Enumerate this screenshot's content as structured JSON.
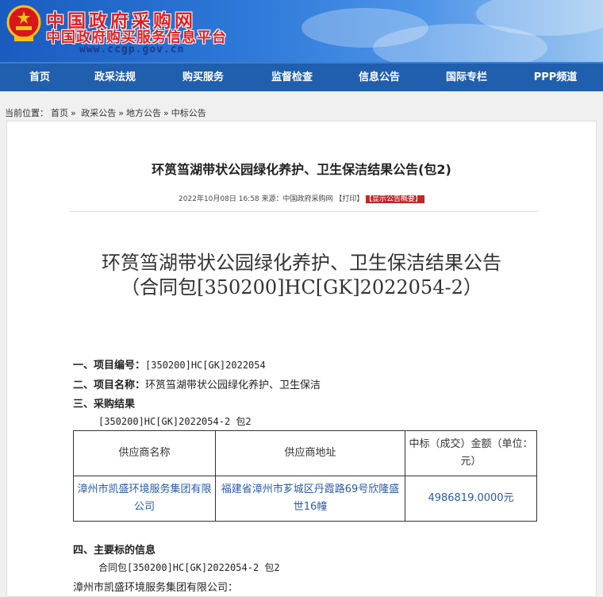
{
  "header": {
    "site_name": "中国政府采购网",
    "site_sub": "中国政府购买服务信息平台",
    "site_url": "www.ccgp.gov.cn"
  },
  "nav": [
    "首页",
    "政采法规",
    "购买服务",
    "监督检查",
    "信息公告",
    "国际专栏",
    "PPP频道"
  ],
  "breadcrumb": {
    "prefix": "当前位置：",
    "items": [
      "首页",
      "政采公告",
      "地方公告",
      "中标公告"
    ],
    "sep": "»"
  },
  "article": {
    "title": "环筼筜湖带状公园绿化养护、卫生保洁结果公告(包2)",
    "meta_date": "2022年10月08日 16:58",
    "meta_source": "来源：中国政府采购网",
    "meta_print": "【打印】",
    "meta_tag": "【显示公告概要】",
    "doc_title_line1": "环筼筜湖带状公园绿化养护、卫生保洁结果公告",
    "doc_title_line2": "（合同包[350200]HC[GK]2022054-2）",
    "s1_label": "一、项目编号：",
    "s1_value": "[350200]HC[GK]2022054",
    "s2_label": "二、项目名称：",
    "s2_value": "环筼筜湖带状公园绿化养护、卫生保洁",
    "s3_label": "三、采购结果",
    "s3_pkg": "[350200]HC[GK]2022054-2 包2",
    "table": {
      "headers": [
        "供应商名称",
        "供应商地址",
        "中标（成交）金额（单位：元）"
      ],
      "rows": [
        {
          "name": "漳州市凯盛环境服务集团有限公司",
          "address": "福建省漳州市芗城区丹霞路69号欣隆盛世16幢",
          "amount": "4986819.0000元"
        }
      ]
    },
    "s4_label": "四、主要标的信息",
    "s4_pkg": "合同包[350200]HC[GK]2022054-2 包2",
    "s4_company": "漳州市凯盛环境服务集团有限公司："
  },
  "colors": {
    "nav_bg": "#1f5fae",
    "brand_red": "#e02020",
    "tag_red": "#c0282c",
    "link_blue": "#2a5aa8"
  }
}
